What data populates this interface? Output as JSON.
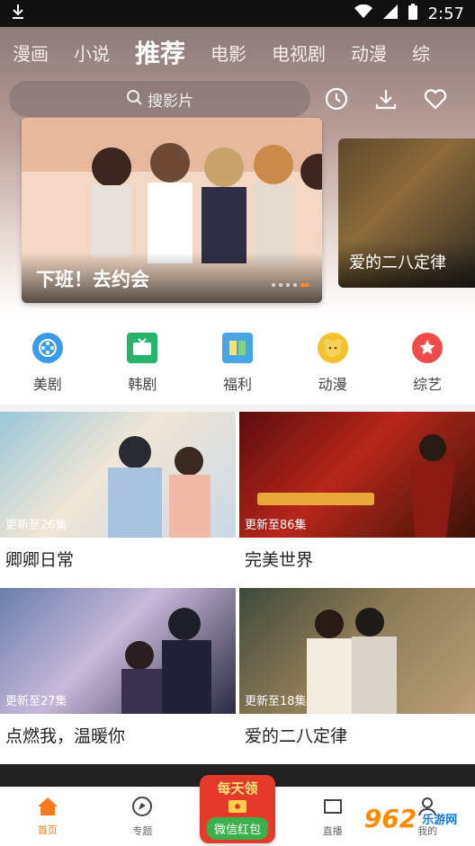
{
  "status": {
    "time": "2:57"
  },
  "nav": {
    "tabs": [
      {
        "label": "漫画",
        "active": false
      },
      {
        "label": "小说",
        "active": false
      },
      {
        "label": "推荐",
        "active": true
      },
      {
        "label": "电影",
        "active": false
      },
      {
        "label": "电视剧",
        "active": false
      },
      {
        "label": "动漫",
        "active": false
      },
      {
        "label": "综",
        "active": false
      }
    ]
  },
  "search": {
    "placeholder": "搜影片"
  },
  "header_icons": [
    "history-icon",
    "download-icon",
    "favorite-icon"
  ],
  "banner": {
    "main_title": "下班！去约会",
    "side_title": "爱的二八定律",
    "slide_count": 5,
    "active_slide": 4
  },
  "categories": [
    {
      "label": "美剧",
      "icon": "film-reel-icon",
      "color": "#3a9be8"
    },
    {
      "label": "韩剧",
      "icon": "tv-icon",
      "color": "#27b36b"
    },
    {
      "label": "福利",
      "icon": "book-stack-icon",
      "color": "#48a6e6"
    },
    {
      "label": "动漫",
      "icon": "bear-icon",
      "color": "#f5c12e"
    },
    {
      "label": "综艺",
      "icon": "star-badge-icon",
      "color": "#f04b4b"
    }
  ],
  "cards": [
    {
      "title": "卿卿日常",
      "update": "更新至26集"
    },
    {
      "title": "完美世界",
      "update": "更新至86集"
    },
    {
      "title": "点燃我，温暖你",
      "update": "更新至27集"
    },
    {
      "title": "爱的二八定律",
      "update": "更新至18集"
    }
  ],
  "bottom_nav": [
    {
      "label": "首页",
      "active": true
    },
    {
      "label": "专题",
      "active": false
    },
    {
      "label": "直播",
      "active": false
    },
    {
      "label": "我的",
      "active": false
    }
  ],
  "promo": {
    "top": "每天领",
    "bottom": "微信红包"
  },
  "watermark": {
    "logo": "962",
    "text": "乐游网"
  },
  "colors": {
    "accent": "#ff7a1a"
  }
}
